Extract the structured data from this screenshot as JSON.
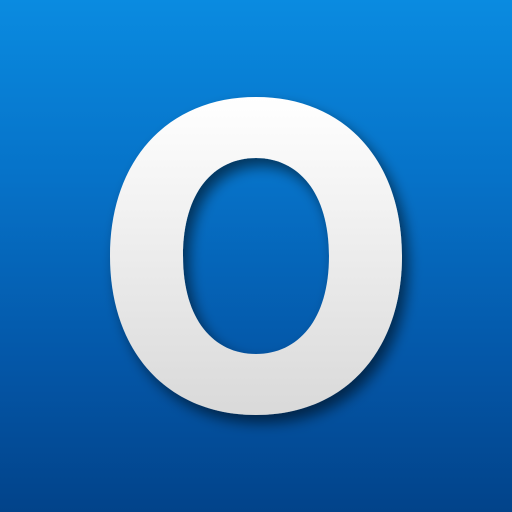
{
  "icon": {
    "glyph": "O",
    "semantic": "letter-o-logo-icon",
    "colors": {
      "background_top": "#0a8be0",
      "background_bottom": "#02438a",
      "glyph_top": "#ffffff",
      "glyph_bottom": "#d9d9d9",
      "shadow": "#001a3d"
    }
  }
}
